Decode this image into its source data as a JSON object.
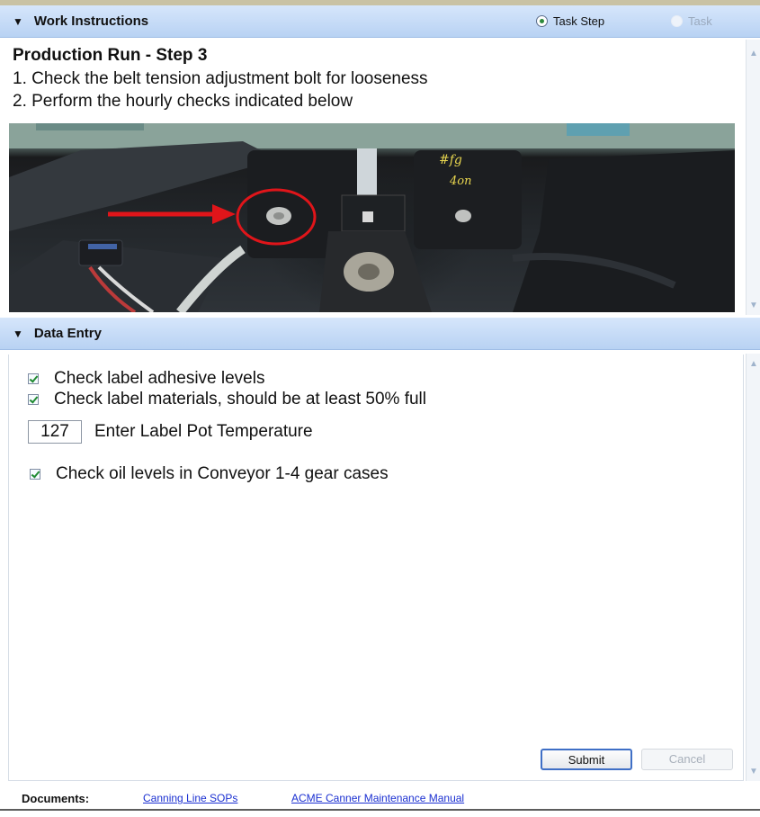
{
  "work_instructions": {
    "header_title": "Work Instructions",
    "radio_options": [
      {
        "label": "Task Step",
        "selected": true
      },
      {
        "label": "Task",
        "selected": false
      }
    ],
    "title": "Production Run - Step 3",
    "steps": [
      "1.  Check the belt tension adjustment bolt for looseness",
      "2.  Perform the hourly checks indicated below"
    ]
  },
  "data_entry": {
    "header_title": "Data Entry",
    "checks": [
      {
        "label": "Check label adhesive levels",
        "checked": true
      },
      {
        "label": "Check label materials, should be at least 50% full",
        "checked": true
      }
    ],
    "temperature": {
      "value": "127",
      "label": "Enter Label Pot Temperature"
    },
    "oil_check": {
      "label": "Check oil levels in Conveyor 1-4 gear cases",
      "checked": true
    },
    "submit_label": "Submit",
    "cancel_label": "Cancel"
  },
  "documents": {
    "label": "Documents:",
    "links": [
      "Canning Line SOPs",
      "ACME Canner Maintenance Manual"
    ]
  },
  "colors": {
    "header_gradient": "#c7dcf6",
    "accent_link": "#1a2fd1",
    "check_green": "#1f8a31",
    "annotation_red": "#e0151a"
  },
  "icons": [
    "collapse-triangle-icon",
    "radio-selected-icon",
    "radio-unselected-icon",
    "checkbox-checked-icon",
    "scroll-up-arrow-icon",
    "scroll-down-arrow-icon"
  ]
}
